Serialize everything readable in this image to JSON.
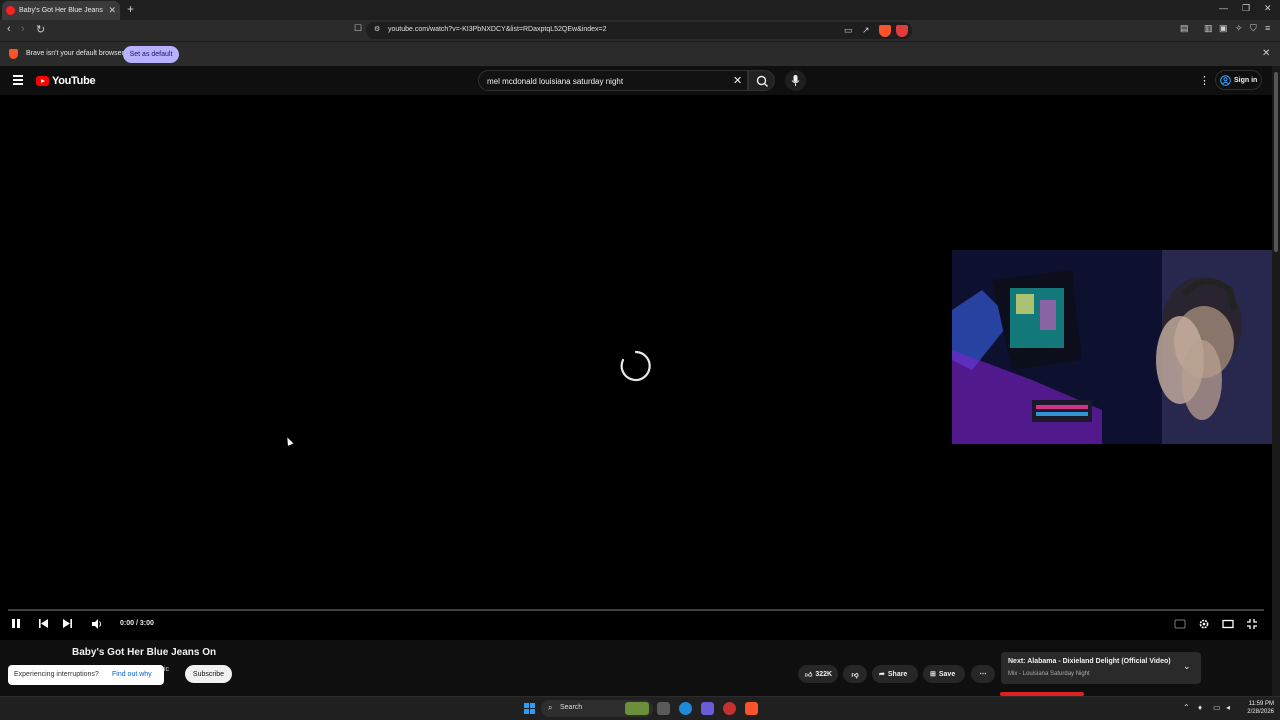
{
  "browser": {
    "tab_title": "Baby's Got Her Blue Jeans On - Y",
    "url": "youtube.com/watch?v=-KI3PbNXDCY&list=RDaxptqL52QEw&index=2",
    "infobar_text": "Brave isn't your default browser",
    "set_default_label": "Set as default"
  },
  "youtube": {
    "logo_text": "YouTube",
    "search_query": "mel mcdonald louisiana saturday night",
    "signin_label": "Sign in"
  },
  "player": {
    "time_display": "0:00 / 3:00",
    "progress_fraction": 0.0,
    "state": "loading"
  },
  "video": {
    "title": "Baby's Got Her Blue Jeans On",
    "channel_fragment": "ic",
    "subscribe_label": "Subscribe",
    "likes": "322K",
    "share_label": "Share",
    "save_label": "Save"
  },
  "interruption": {
    "question": "Experiencing interruptions?",
    "link": "Find out why"
  },
  "next_up": {
    "title": "Next: Alabama - Dixieland Delight (Official Video)",
    "subtitle": "Mix - Louisiana Saturday Night"
  },
  "taskbar": {
    "search_label": "Search",
    "time": "11:59 PM",
    "date": "2/28/2026"
  },
  "colors": {
    "brand_red": "#ff0000",
    "brave_orange": "#fb542b",
    "set_default_bg": "#b8b1ff"
  }
}
